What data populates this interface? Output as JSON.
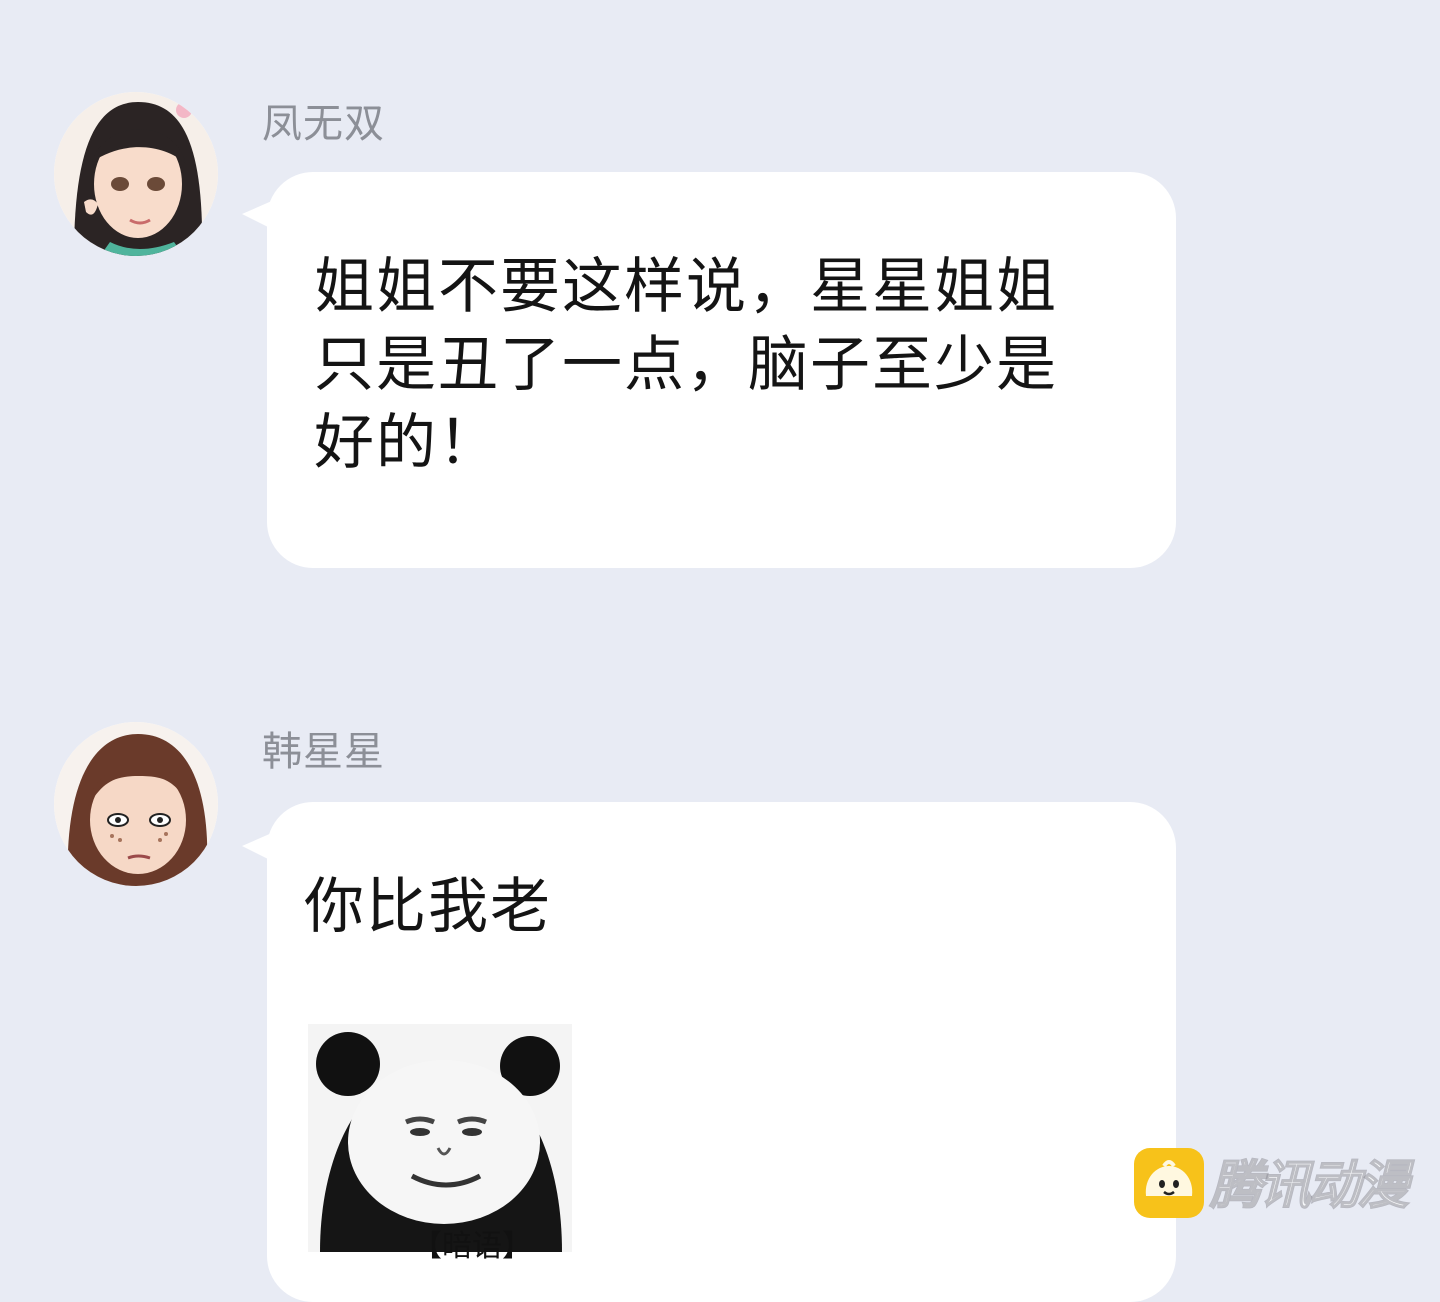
{
  "messages": [
    {
      "sender": "凤无双",
      "text": "姐姐不要这样说，星星姐姐\n只是丑了一点，脑子至少是\n好的！"
    },
    {
      "sender": "韩星星",
      "text": "你比我老",
      "sticker_caption": "【暗语】"
    }
  ],
  "watermark": {
    "text": "腾讯动漫",
    "logo_icon": "bun-face-icon",
    "logo_color": "#f7c21a"
  },
  "colors": {
    "background": "#e8ebf4",
    "bubble": "#ffffff",
    "sender_name": "#8c8f97",
    "message_text": "#141414"
  }
}
